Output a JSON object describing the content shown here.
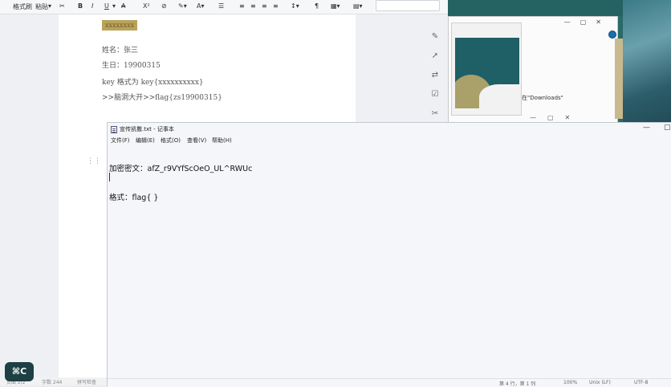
{
  "word": {
    "ribbon": {
      "format_painter": "格式刷",
      "paste": "粘贴",
      "bold": "B",
      "italic": "I",
      "underline": "U",
      "strike": "A",
      "superscript": "X²"
    },
    "doc": {
      "highlight_line": "xxxxxxxx",
      "name_line": "姓名：张三",
      "birthday_line": "生日：19900315",
      "key_format_line": "key 格式为 key{xxxxxxxxxx}",
      "flag_line": ">>脑洞大开>>flag{zs19900315}"
    },
    "status": {
      "page": "页面 2/2",
      "words": "字数 244",
      "spell": "拼写检查"
    }
  },
  "explorer": {
    "downloads_text": "在\"Downloads\""
  },
  "notepad": {
    "title": "宣传凯撒.txt - 记事本",
    "menu": [
      "文件(F)",
      "编辑(E)",
      "格式(O)",
      "查看(V)",
      "帮助(H)"
    ],
    "content_line1": "加密密文：afZ_r9VYfScOeO_UL^RWUc",
    "content_line2": "格式：flag{ }",
    "status": {
      "position": "第 4 行，第 1 列",
      "zoom": "100%",
      "line_ending": "Unix (LF)",
      "encoding": "UTF-8"
    }
  },
  "shortcut_badge": "⌘C"
}
